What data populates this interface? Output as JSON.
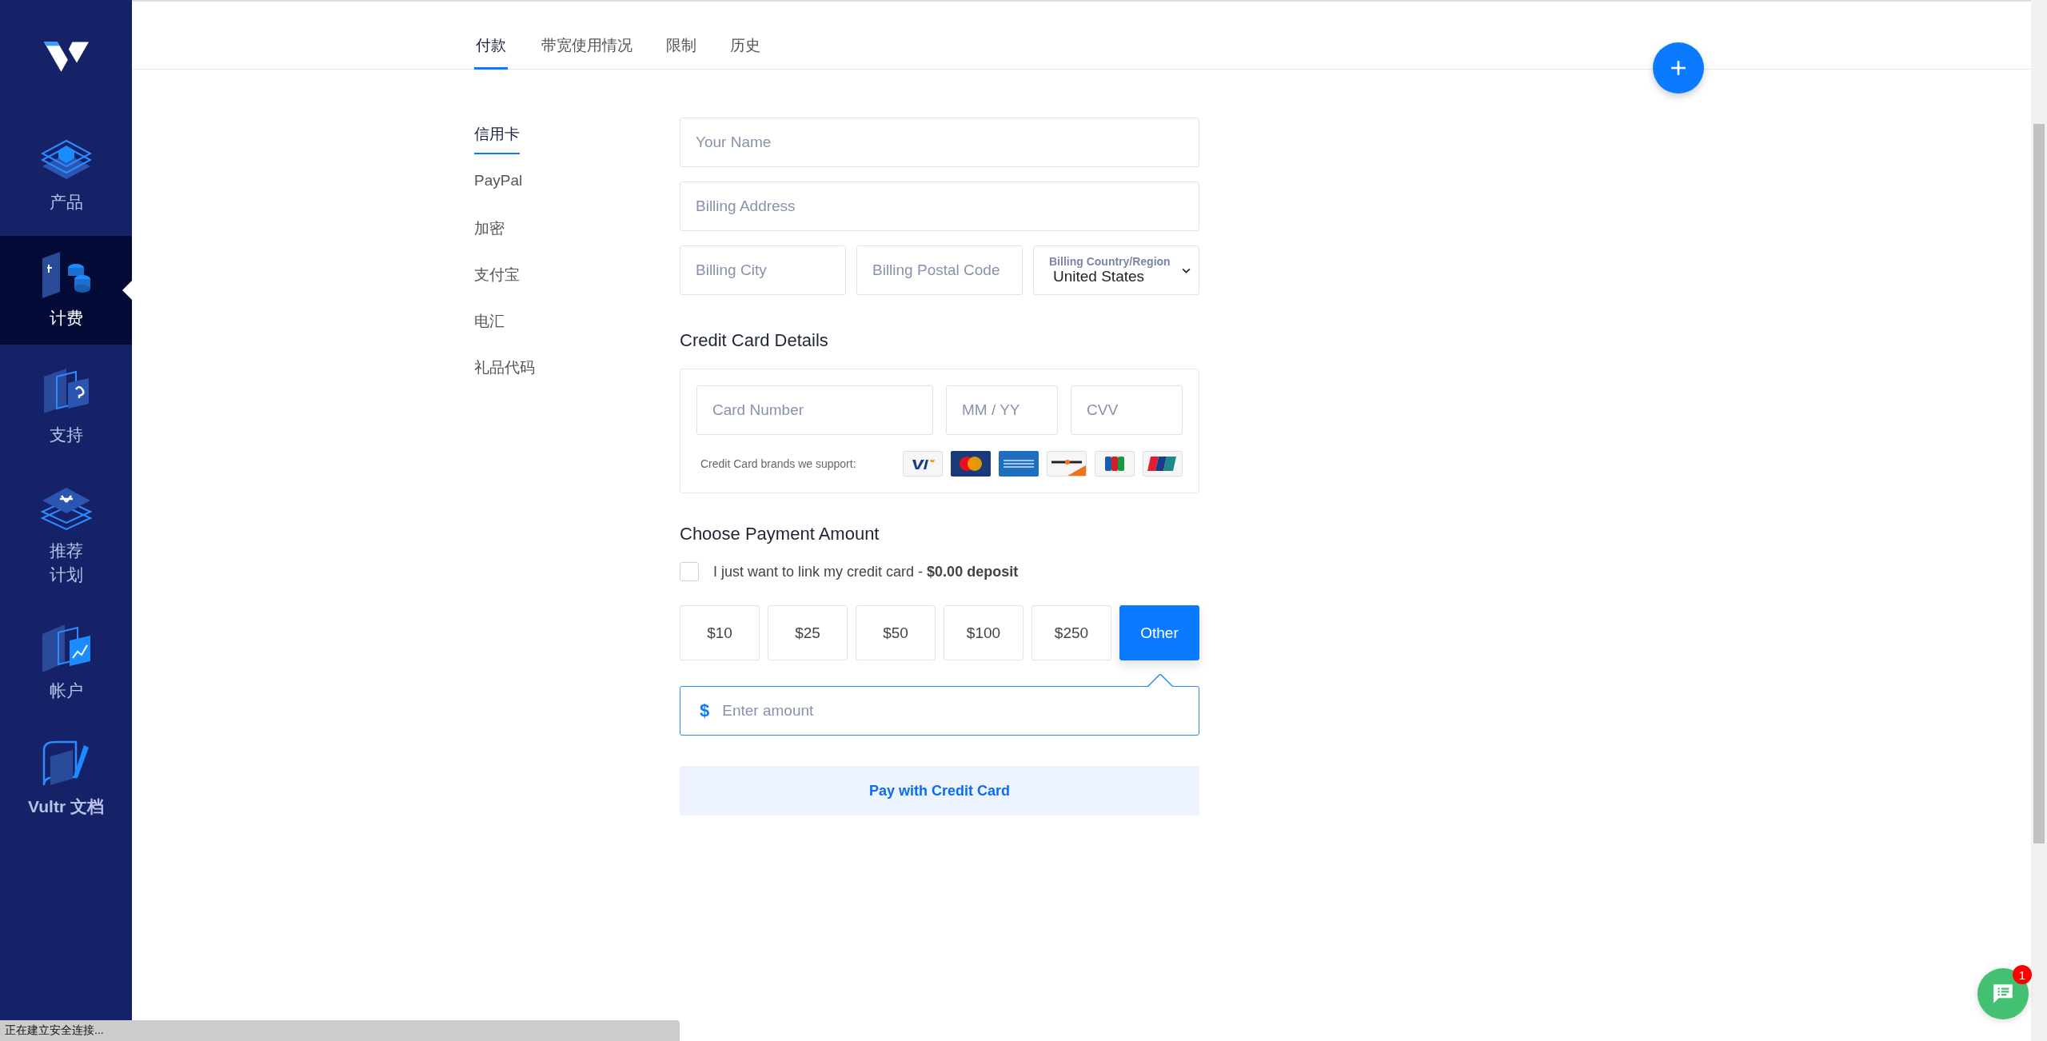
{
  "sidebar": {
    "items": [
      {
        "label": "产品",
        "kind": "product",
        "selected": false
      },
      {
        "label": "计费",
        "kind": "billing",
        "selected": true
      },
      {
        "label": "支持",
        "kind": "support",
        "selected": false
      },
      {
        "label": "推荐计划",
        "kind": "referral",
        "selected": false
      },
      {
        "label": "帐户",
        "kind": "account",
        "selected": false
      },
      {
        "label": "Vultr 文档",
        "kind": "docs",
        "selected": false
      }
    ]
  },
  "tabs": [
    {
      "label": "付款",
      "selected": true
    },
    {
      "label": "带宽使用情况",
      "selected": false
    },
    {
      "label": "限制",
      "selected": false
    },
    {
      "label": "历史",
      "selected": false
    }
  ],
  "methods": [
    {
      "label": "信用卡",
      "selected": true
    },
    {
      "label": "PayPal",
      "selected": false
    },
    {
      "label": "加密",
      "selected": false
    },
    {
      "label": "支付宝",
      "selected": false
    },
    {
      "label": "电汇",
      "selected": false
    },
    {
      "label": "礼品代码",
      "selected": false
    }
  ],
  "billing": {
    "name": {
      "placeholder": "Your Name"
    },
    "address": {
      "placeholder": "Billing Address"
    },
    "city": {
      "placeholder": "Billing City"
    },
    "postal": {
      "placeholder": "Billing Postal Code"
    },
    "country": {
      "label": "Billing Country/Region",
      "value": "United States"
    }
  },
  "card": {
    "title": "Credit Card Details",
    "number": {
      "placeholder": "Card Number"
    },
    "expiry": {
      "placeholder": "MM / YY"
    },
    "cvv": {
      "placeholder": "CVV"
    },
    "brands_label": "Credit Card brands we support:",
    "brands": [
      {
        "kind": "visa"
      },
      {
        "kind": "mastercard"
      },
      {
        "kind": "amex"
      },
      {
        "kind": "discover"
      },
      {
        "kind": "jcb"
      },
      {
        "kind": "unionpay"
      }
    ]
  },
  "amount": {
    "title": "Choose Payment Amount",
    "link_card": {
      "text": "I just want to link my credit card - **$0.00 deposit**",
      "checked": false
    },
    "options": [
      {
        "label": "$10",
        "selected": false
      },
      {
        "label": "$25",
        "selected": false
      },
      {
        "label": "$50",
        "selected": false
      },
      {
        "label": "$100",
        "selected": false
      },
      {
        "label": "$250",
        "selected": false
      },
      {
        "label": "Other",
        "selected": true
      }
    ],
    "custom": {
      "symbol": "$",
      "placeholder": "Enter amount"
    }
  },
  "pay_button": "Pay with Credit Card",
  "chat": {
    "badge": "1"
  },
  "status_bar": "正在建立安全连接..."
}
